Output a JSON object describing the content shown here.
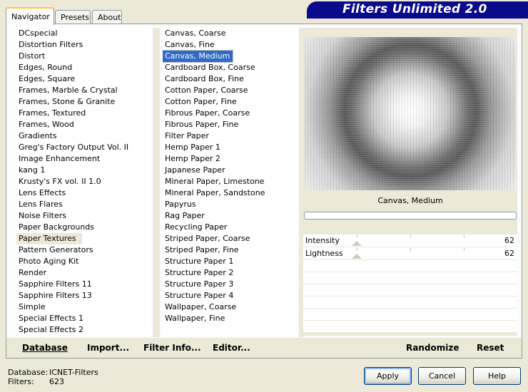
{
  "tabs": [
    "Navigator",
    "Presets",
    "About"
  ],
  "banner_title": "Filters Unlimited 2.0",
  "categories": [
    "DCspecial",
    "Distortion Filters",
    "Distort",
    "Edges, Round",
    "Edges, Square",
    "Frames, Marble & Crystal",
    "Frames, Stone & Granite",
    "Frames, Textured",
    "Frames, Wood",
    "Gradients",
    "Greg's Factory Output Vol. II",
    "Image Enhancement",
    "kang 1",
    "Krusty's FX vol. II 1.0",
    "Lens Effects",
    "Lens Flares",
    "Noise Filters",
    "Paper Backgrounds",
    "Paper Textures",
    "Pattern Generators",
    "Photo Aging Kit",
    "Render",
    "Sapphire Filters 11",
    "Sapphire Filters 13",
    "Simple",
    "Special Effects 1",
    "Special Effects 2"
  ],
  "selected_category": "Paper Textures",
  "filters": [
    "Canvas, Coarse",
    "Canvas, Fine",
    "Canvas, Medium",
    "Cardboard Box, Coarse",
    "Cardboard Box, Fine",
    "Cotton Paper, Coarse",
    "Cotton Paper, Fine",
    "Fibrous Paper, Coarse",
    "Fibrous Paper, Fine",
    "Filter Paper",
    "Hemp Paper 1",
    "Hemp Paper 2",
    "Japanese Paper",
    "Mineral Paper, Limestone",
    "Mineral Paper, Sandstone",
    "Papyrus",
    "Rag Paper",
    "Recycling Paper",
    "Striped Paper, Coarse",
    "Striped Paper, Fine",
    "Structure Paper 1",
    "Structure Paper 2",
    "Structure Paper 3",
    "Structure Paper 4",
    "Wallpaper, Coarse",
    "Wallpaper, Fine"
  ],
  "selected_filter": "Canvas, Medium",
  "preview": {
    "filter_name": "Canvas, Medium"
  },
  "sliders": [
    {
      "label": "Intensity",
      "value": "62"
    },
    {
      "label": "Lightness",
      "value": "62"
    }
  ],
  "toolbar": {
    "database": "Database",
    "import": "Import...",
    "filter_info": "Filter Info...",
    "editor": "Editor...",
    "randomize": "Randomize",
    "reset": "Reset"
  },
  "info": {
    "database_label": "Database:",
    "database_value": "ICNET-Filters",
    "filters_label": "Filters:",
    "filters_value": "623"
  },
  "buttons": {
    "apply": "Apply",
    "cancel": "Cancel",
    "help": "Help"
  }
}
